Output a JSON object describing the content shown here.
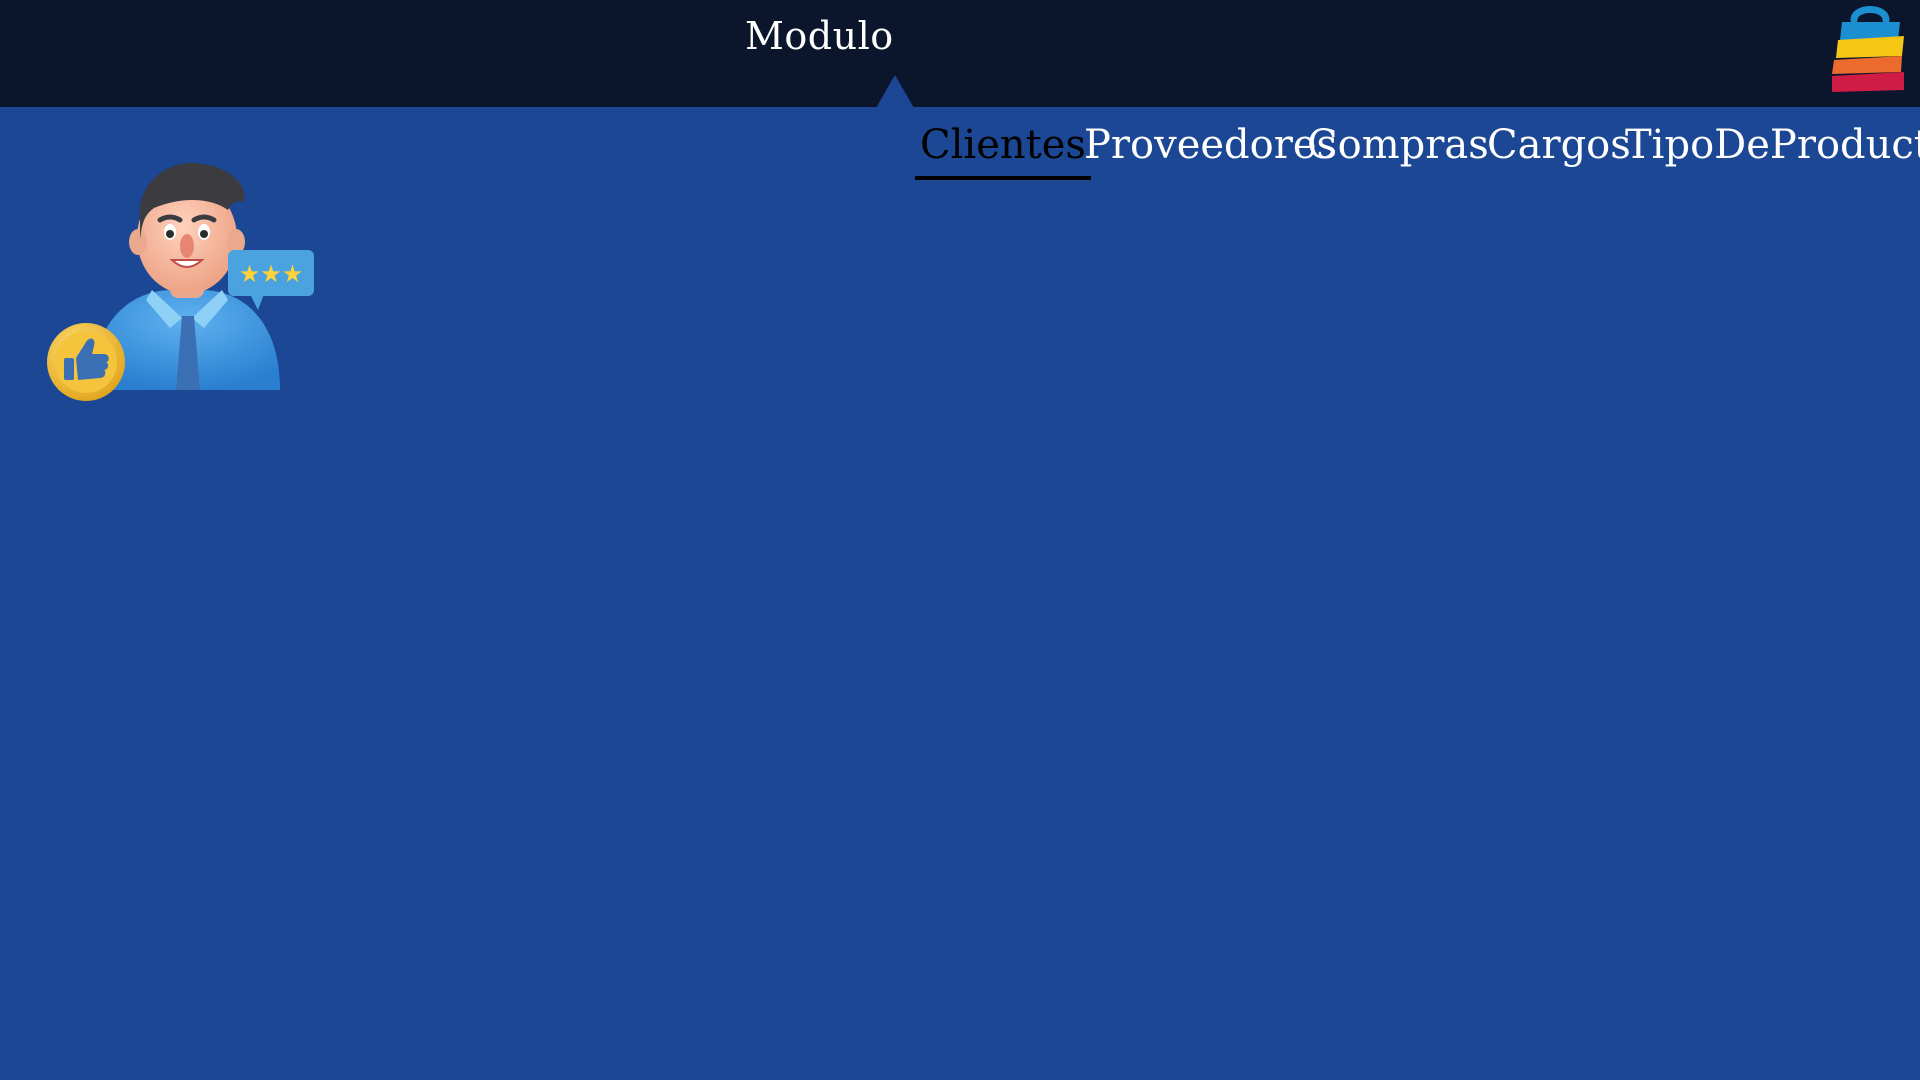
{
  "header": {
    "module_label": "Modulo",
    "logo_icon": "shopping-bag-logo-icon"
  },
  "tabs": [
    {
      "label": "Clientes",
      "active": true
    },
    {
      "label": "Proveedores",
      "active": false
    },
    {
      "label": "Compras",
      "active": false
    },
    {
      "label": "Cargos",
      "active": false
    },
    {
      "label": "TipoDeProducto",
      "active": false
    }
  ],
  "illustration": {
    "icon": "customer-avatar-icon",
    "badges": [
      "thumbs-up-icon",
      "star-rating-icon"
    ]
  },
  "colors": {
    "topbar": "#0b162d",
    "background": "#1b4794",
    "active_tab": "#000000",
    "tab_text": "#ffffff"
  }
}
